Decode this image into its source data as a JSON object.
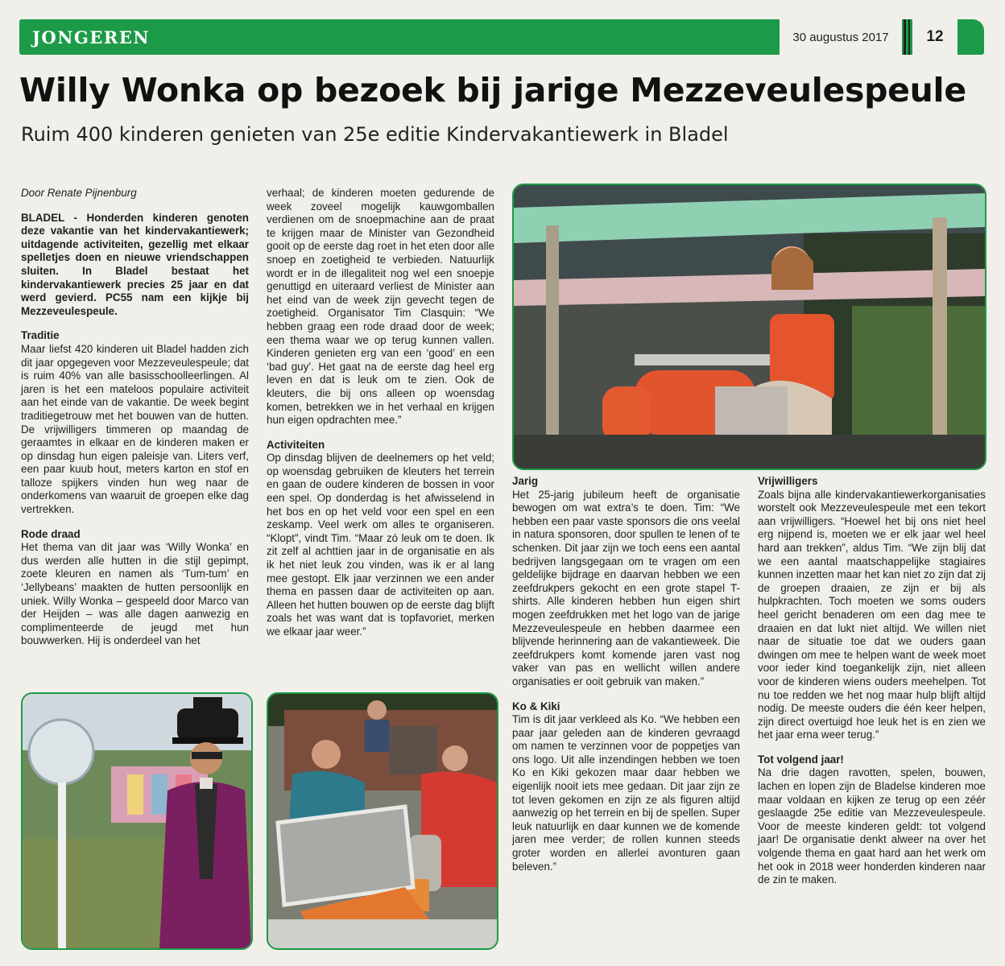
{
  "header": {
    "section": "JONGEREN",
    "date": "30 augustus 2017",
    "page_number": "12"
  },
  "headline": "Willy Wonka op bezoek bij jarige Mezzeveulespeule",
  "subheadline": "Ruim 400 kinderen genieten van 25e editie Kindervakantiewerk in Bladel",
  "byline": "Door Renate Pijnenburg",
  "lead": "BLADEL - Honderden kinderen genoten deze vakantie van het kindervakantiewerk; uitdagende activiteiten, gezellig met elkaar spelletjes doen en nieuwe vriendschappen sluiten. In Bladel bestaat het kindervakantiewerk precies 25 jaar en dat werd gevierd. PC55 nam een kijkje bij Mezzeveulespeule.",
  "sections": {
    "traditie": {
      "heading": "Traditie",
      "text": "Maar liefst 420 kinderen uit Bladel hadden zich dit jaar opgegeven voor Mezzeveulespeule; dat is ruim 40% van alle basisschoolleerlingen. Al jaren is het een mateloos populaire activiteit aan het einde van de vakantie. De week begint traditiegetrouw met het bouwen van de hutten. De vrijwilligers timmeren op maandag de geraamtes in elkaar en de kinderen maken er op dinsdag hun eigen paleisje van. Liters verf, een paar kuub hout, meters karton en stof en talloze spijkers vinden hun weg naar de onderkomens van waaruit de groepen elke dag vertrekken."
    },
    "rode_draad": {
      "heading": "Rode draad",
      "text": "Het thema van dit jaar was ‘Willy Wonka’ en dus werden alle hutten in die stijl gepimpt, zoete kleuren en namen als ‘Tum-tum’ en ‘Jellybeans’ maakten de hutten persoonlijk en uniek. Willy Wonka – gespeeld door Marco van der Heijden – was alle dagen aanwezig en complimenteerde de jeugd met hun bouwwerken. Hij is onderdeel van het",
      "continued": "verhaal; de kinderen moeten gedurende de week zoveel mogelijk kauwgomballen verdienen om de snoepmachine aan de praat te krijgen maar de Minister van Gezondheid gooit op de eerste dag roet in het eten door alle snoep en zoetigheid te verbieden. Natuurlijk wordt er in de illegaliteit nog wel een snoepje genuttigd en uiteraard verliest de Minister aan het eind van de week zijn gevecht tegen de zoetigheid. Organisator Tim Clasquin: “We hebben graag een rode draad door de week; een thema waar we op terug kunnen vallen. Kinderen genieten erg van een ‘good’ en een ‘bad guy’. Het gaat na de eerste dag heel erg leven en dat is leuk om te zien. Ook de kleuters, die bij ons alleen op woensdag komen, betrekken we in het verhaal en krijgen hun eigen opdrachten mee.”"
    },
    "activiteiten": {
      "heading": "Activiteiten",
      "text": "Op dinsdag blijven de deelnemers op het veld; op woensdag gebruiken de kleuters het terrein en gaan de oudere kinderen de bossen in voor een spel. Op donderdag is het afwisselend in het bos en op het veld voor een spel en een zeskamp. Veel werk om alles te organiseren. “Klopt”, vindt Tim. “Maar zó leuk om te doen. Ik zit zelf al achttien jaar in de organisatie en als ik het niet leuk zou vinden, was ik er al lang mee gestopt. Elk jaar verzinnen we een ander thema en passen daar de activiteiten op aan. Alleen het hutten bouwen op de eerste dag blijft zoals het was want dat is topfavoriet, merken we elkaar jaar weer.”"
    },
    "jarig": {
      "heading": "Jarig",
      "text": "Het 25-jarig jubileum heeft de organisatie bewogen om wat extra’s te doen. Tim: “We hebben een paar vaste sponsors die ons veelal in natura sponsoren, door spullen te lenen of te schenken. Dit jaar zijn we toch eens een aantal bedrijven langsgegaan om te vragen om een geldelijke bijdrage en daarvan hebben we een zeefdrukpers gekocht en een grote stapel T-shirts. Alle kinderen hebben hun eigen shirt mogen zeefdrukken met het logo van de jarige Mezzeveulespeule en hebben daarmee een blijvende herinnering aan de vakantieweek. Die zeefdrukpers komt komende jaren vast nog vaker van pas en wellicht willen andere organisaties er ooit gebruik van maken.”"
    },
    "ko_kiki": {
      "heading": "Ko & Kiki",
      "text": "Tim is dit jaar verkleed als Ko. “We hebben een paar jaar geleden aan de kinderen gevraagd om namen te verzinnen voor de poppetjes van ons logo. Uit alle inzendingen hebben we toen Ko en Kiki gekozen maar daar hebben we eigenlijk nooit iets mee gedaan. Dit jaar zijn ze tot leven gekomen en zijn ze als figuren altijd aanwezig op het terrein en bij de spellen. Super leuk natuurlijk en daar kunnen we de komende jaren mee verder; de rollen kunnen steeds groter worden en allerlei avonturen gaan beleven.”"
    },
    "vrijwilligers": {
      "heading": "Vrijwilligers",
      "text": "Zoals bijna alle kindervakantiewerkorganisaties worstelt ook Mezzeveulespeule met een tekort aan vrijwilligers. “Hoewel het bij ons niet heel erg nijpend is, moeten we er elk jaar wel heel hard aan trekken”, aldus Tim. “We zijn blij dat we een aantal maatschappelijke stagiaires kunnen inzetten maar het kan niet zo zijn dat zij de groepen draaien, ze zijn er bij als hulpkrachten. Toch moeten we soms ouders heel gericht benaderen om een dag mee te draaien en dat lukt niet altijd. We willen niet naar de situatie toe dat we ouders gaan dwingen om mee te helpen want de week moet voor ieder kind toegankelijk zijn, niet alleen voor de kinderen wiens ouders meehelpen. Tot nu toe redden we het nog maar hulp blijft altijd nodig. De meeste ouders die één keer helpen, zijn direct overtuigd hoe leuk het is en zien we het jaar erna weer terug.”"
    },
    "tot_volgend_jaar": {
      "heading": "Tot volgend jaar!",
      "text": "Na drie dagen ravotten, spelen, bouwen, lachen en lopen zijn de Bladelse kinderen moe maar voldaan en kijken ze terug op een zéér geslaagde 25e editie van Mezzeveulespeule. Voor de meeste kinderen geldt: tot volgend jaar! De organisatie denkt alweer na over het volgende thema en gaat hard aan het werk om het ook in 2018 weer honderden kinderen naar de zin te maken."
    }
  },
  "colors": {
    "accent_green": "#1c9a48",
    "paper": "#f1efe9"
  }
}
